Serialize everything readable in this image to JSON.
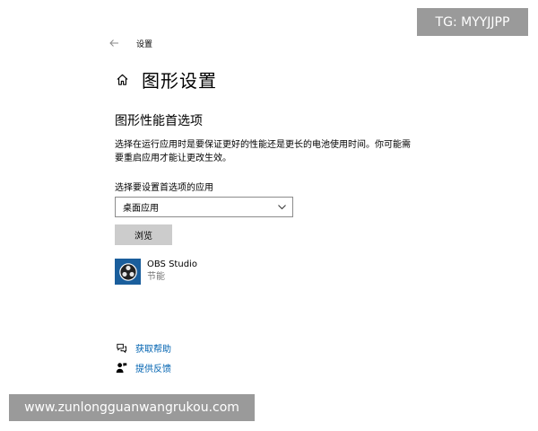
{
  "window": {
    "title": "设置"
  },
  "header": {
    "title": "图形设置"
  },
  "section": {
    "title": "图形性能首选项",
    "description": "选择在运行应用时是要保证更好的性能还是更长的电池使用时间。你可能需要重启应用才能让更改生效。"
  },
  "selector": {
    "label": "选择要设置首选项的应用",
    "value": "桌面应用"
  },
  "browse_button": "浏览",
  "apps": [
    {
      "name": "OBS Studio",
      "preference": "节能"
    }
  ],
  "links": {
    "help": "获取帮助",
    "feedback": "提供反馈"
  },
  "watermarks": {
    "top": "TG: MYYJJPP",
    "bottom": "www.zunlongguanwangrukou.com"
  },
  "colors": {
    "accent": "#0063b1",
    "button_bg": "#cccccc",
    "app_icon_bg": "#1a5e9c",
    "watermark_bg": "#9a9a9a"
  }
}
